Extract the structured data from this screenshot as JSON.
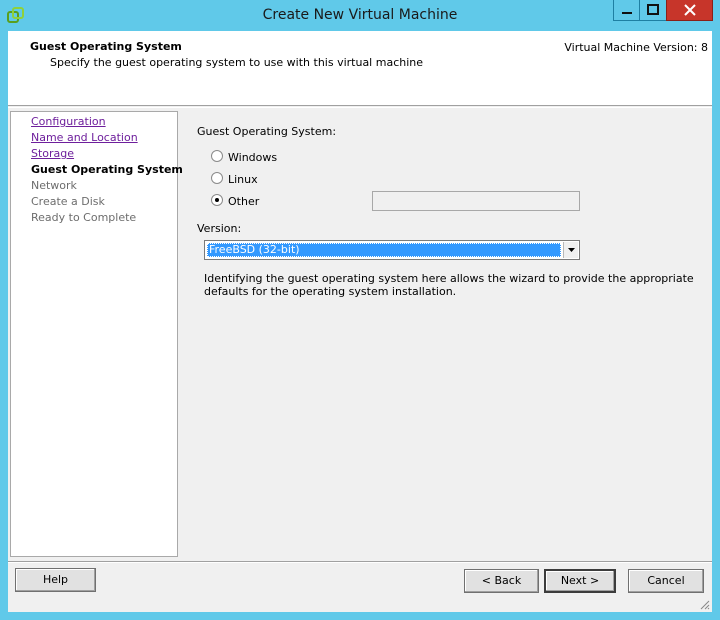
{
  "window": {
    "title": "Create New Virtual Machine",
    "icon": "vsphere-app-icon",
    "controls": {
      "minimize": "minimize-icon",
      "maximize": "maximize-icon",
      "close": "close-icon"
    },
    "colors": {
      "titlebar": "#60c9e9",
      "close": "#c7352a"
    }
  },
  "header": {
    "title": "Guest Operating System",
    "subtitle": "Specify the guest operating system to use with this virtual machine",
    "version": "Virtual Machine Version: 8"
  },
  "steps": [
    {
      "label": "Configuration",
      "state": "completed"
    },
    {
      "label": "Name and Location",
      "state": "completed"
    },
    {
      "label": "Storage",
      "state": "completed"
    },
    {
      "label": "Guest Operating System",
      "state": "current"
    },
    {
      "label": "Network",
      "state": "future"
    },
    {
      "label": "Create a Disk",
      "state": "future"
    },
    {
      "label": "Ready to Complete",
      "state": "future"
    }
  ],
  "main": {
    "guest_os_label": "Guest Operating System:",
    "options": [
      {
        "label": "Windows",
        "selected": false
      },
      {
        "label": "Linux",
        "selected": false
      },
      {
        "label": "Other",
        "selected": true
      }
    ],
    "other_value": "",
    "version_label": "Version:",
    "version_value": "FreeBSD (32-bit)",
    "description": "Identifying the guest operating system here allows the wizard to provide the appropriate defaults for the operating system installation."
  },
  "buttons": {
    "help": "Help",
    "back": "< Back",
    "next": "Next >",
    "cancel": "Cancel"
  }
}
